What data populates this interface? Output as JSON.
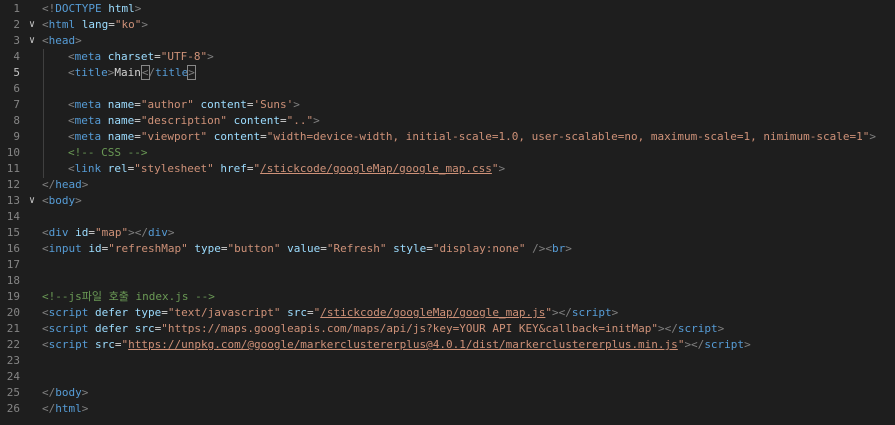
{
  "editor": {
    "language": "html",
    "current_line": 5,
    "lines": [
      {
        "num": "1",
        "fold": "",
        "tokens": [
          {
            "t": "b",
            "v": "<!"
          },
          {
            "t": "tag",
            "v": "DOCTYPE"
          },
          {
            "t": "p",
            "v": " "
          },
          {
            "t": "attr",
            "v": "html"
          },
          {
            "t": "b",
            "v": ">"
          }
        ]
      },
      {
        "num": "2",
        "fold": "v",
        "tokens": [
          {
            "t": "b",
            "v": "<"
          },
          {
            "t": "tag",
            "v": "html"
          },
          {
            "t": "p",
            "v": " "
          },
          {
            "t": "attr",
            "v": "lang"
          },
          {
            "t": "p",
            "v": "="
          },
          {
            "t": "str",
            "v": "\"ko\""
          },
          {
            "t": "b",
            "v": ">"
          }
        ]
      },
      {
        "num": "3",
        "fold": "v",
        "tokens": [
          {
            "t": "b",
            "v": "<"
          },
          {
            "t": "tag",
            "v": "head"
          },
          {
            "t": "b",
            "v": ">"
          }
        ]
      },
      {
        "num": "4",
        "fold": "",
        "indent": 1,
        "tokens": [
          {
            "t": "b",
            "v": "<"
          },
          {
            "t": "tag",
            "v": "meta"
          },
          {
            "t": "p",
            "v": " "
          },
          {
            "t": "attr",
            "v": "charset"
          },
          {
            "t": "p",
            "v": "="
          },
          {
            "t": "str",
            "v": "\"UTF-8\""
          },
          {
            "t": "b",
            "v": ">"
          }
        ]
      },
      {
        "num": "5",
        "fold": "",
        "indent": 1,
        "tokens": [
          {
            "t": "b",
            "v": "<"
          },
          {
            "t": "tag",
            "v": "title"
          },
          {
            "t": "b",
            "v": ">"
          },
          {
            "t": "p",
            "v": "Main"
          },
          {
            "t": "hlb",
            "v": "<"
          },
          {
            "t": "b",
            "v": "/"
          },
          {
            "t": "tag",
            "v": "title"
          },
          {
            "t": "hlb",
            "v": ">"
          }
        ]
      },
      {
        "num": "6",
        "fold": "",
        "indent": 1,
        "tokens": []
      },
      {
        "num": "7",
        "fold": "",
        "indent": 1,
        "tokens": [
          {
            "t": "b",
            "v": "<"
          },
          {
            "t": "tag",
            "v": "meta"
          },
          {
            "t": "p",
            "v": " "
          },
          {
            "t": "attr",
            "v": "name"
          },
          {
            "t": "p",
            "v": "="
          },
          {
            "t": "str",
            "v": "\"author\""
          },
          {
            "t": "p",
            "v": " "
          },
          {
            "t": "attr",
            "v": "content"
          },
          {
            "t": "p",
            "v": "="
          },
          {
            "t": "str",
            "v": "'Suns'"
          },
          {
            "t": "b",
            "v": ">"
          }
        ]
      },
      {
        "num": "8",
        "fold": "",
        "indent": 1,
        "tokens": [
          {
            "t": "b",
            "v": "<"
          },
          {
            "t": "tag",
            "v": "meta"
          },
          {
            "t": "p",
            "v": " "
          },
          {
            "t": "attr",
            "v": "name"
          },
          {
            "t": "p",
            "v": "="
          },
          {
            "t": "str",
            "v": "\"description\""
          },
          {
            "t": "p",
            "v": " "
          },
          {
            "t": "attr",
            "v": "content"
          },
          {
            "t": "p",
            "v": "="
          },
          {
            "t": "str",
            "v": "\"..\""
          },
          {
            "t": "b",
            "v": ">"
          }
        ]
      },
      {
        "num": "9",
        "fold": "",
        "indent": 1,
        "tokens": [
          {
            "t": "b",
            "v": "<"
          },
          {
            "t": "tag",
            "v": "meta"
          },
          {
            "t": "p",
            "v": " "
          },
          {
            "t": "attr",
            "v": "name"
          },
          {
            "t": "p",
            "v": "="
          },
          {
            "t": "str",
            "v": "\"viewport\""
          },
          {
            "t": "p",
            "v": " "
          },
          {
            "t": "attr",
            "v": "content"
          },
          {
            "t": "p",
            "v": "="
          },
          {
            "t": "str",
            "v": "\"width=device-width, initial-scale=1.0, user-scalable=no, maximum-scale=1, nimimum-scale=1\""
          },
          {
            "t": "b",
            "v": ">"
          }
        ]
      },
      {
        "num": "10",
        "fold": "",
        "indent": 1,
        "tokens": [
          {
            "t": "comment",
            "v": "<!-- CSS -->"
          }
        ]
      },
      {
        "num": "11",
        "fold": "",
        "indent": 1,
        "tokens": [
          {
            "t": "b",
            "v": "<"
          },
          {
            "t": "tag",
            "v": "link"
          },
          {
            "t": "p",
            "v": " "
          },
          {
            "t": "attr",
            "v": "rel"
          },
          {
            "t": "p",
            "v": "="
          },
          {
            "t": "str",
            "v": "\"stylesheet\""
          },
          {
            "t": "p",
            "v": " "
          },
          {
            "t": "attr",
            "v": "href"
          },
          {
            "t": "p",
            "v": "="
          },
          {
            "t": "str",
            "v": "\""
          },
          {
            "t": "link",
            "v": "/stickcode/googleMap/google_map.css"
          },
          {
            "t": "str",
            "v": "\""
          },
          {
            "t": "b",
            "v": ">"
          }
        ]
      },
      {
        "num": "12",
        "fold": "",
        "tokens": [
          {
            "t": "b",
            "v": "</"
          },
          {
            "t": "tag",
            "v": "head"
          },
          {
            "t": "b",
            "v": ">"
          }
        ]
      },
      {
        "num": "13",
        "fold": "v",
        "tokens": [
          {
            "t": "b",
            "v": "<"
          },
          {
            "t": "tag",
            "v": "body"
          },
          {
            "t": "b",
            "v": ">"
          }
        ]
      },
      {
        "num": "14",
        "fold": "",
        "tokens": []
      },
      {
        "num": "15",
        "fold": "",
        "tokens": [
          {
            "t": "b",
            "v": "<"
          },
          {
            "t": "tag",
            "v": "div"
          },
          {
            "t": "p",
            "v": " "
          },
          {
            "t": "attr",
            "v": "id"
          },
          {
            "t": "p",
            "v": "="
          },
          {
            "t": "str",
            "v": "\"map\""
          },
          {
            "t": "b",
            "v": "></"
          },
          {
            "t": "tag",
            "v": "div"
          },
          {
            "t": "b",
            "v": ">"
          }
        ]
      },
      {
        "num": "16",
        "fold": "",
        "tokens": [
          {
            "t": "b",
            "v": "<"
          },
          {
            "t": "tag",
            "v": "input"
          },
          {
            "t": "p",
            "v": " "
          },
          {
            "t": "attr",
            "v": "id"
          },
          {
            "t": "p",
            "v": "="
          },
          {
            "t": "str",
            "v": "\"refreshMap\""
          },
          {
            "t": "p",
            "v": " "
          },
          {
            "t": "attr",
            "v": "type"
          },
          {
            "t": "p",
            "v": "="
          },
          {
            "t": "str",
            "v": "\"button\""
          },
          {
            "t": "p",
            "v": " "
          },
          {
            "t": "attr",
            "v": "value"
          },
          {
            "t": "p",
            "v": "="
          },
          {
            "t": "str",
            "v": "\"Refresh\""
          },
          {
            "t": "p",
            "v": " "
          },
          {
            "t": "attr",
            "v": "style"
          },
          {
            "t": "p",
            "v": "="
          },
          {
            "t": "str",
            "v": "\"display:none\""
          },
          {
            "t": "p",
            "v": " "
          },
          {
            "t": "b",
            "v": "/><"
          },
          {
            "t": "tag",
            "v": "br"
          },
          {
            "t": "b",
            "v": ">"
          }
        ]
      },
      {
        "num": "17",
        "fold": "",
        "tokens": []
      },
      {
        "num": "18",
        "fold": "",
        "tokens": []
      },
      {
        "num": "19",
        "fold": "",
        "tokens": [
          {
            "t": "comment",
            "v": "<!--js파일 호출 index.js -->"
          }
        ]
      },
      {
        "num": "20",
        "fold": "",
        "tokens": [
          {
            "t": "b",
            "v": "<"
          },
          {
            "t": "tag",
            "v": "script"
          },
          {
            "t": "p",
            "v": " "
          },
          {
            "t": "attr",
            "v": "defer"
          },
          {
            "t": "p",
            "v": " "
          },
          {
            "t": "attr",
            "v": "type"
          },
          {
            "t": "p",
            "v": "="
          },
          {
            "t": "str",
            "v": "\"text/javascript\""
          },
          {
            "t": "p",
            "v": " "
          },
          {
            "t": "attr",
            "v": "src"
          },
          {
            "t": "p",
            "v": "="
          },
          {
            "t": "str",
            "v": "\""
          },
          {
            "t": "link",
            "v": "/stickcode/googleMap/google_map.js"
          },
          {
            "t": "str",
            "v": "\""
          },
          {
            "t": "b",
            "v": "></"
          },
          {
            "t": "tag",
            "v": "script"
          },
          {
            "t": "b",
            "v": ">"
          }
        ]
      },
      {
        "num": "21",
        "fold": "",
        "tokens": [
          {
            "t": "b",
            "v": "<"
          },
          {
            "t": "tag",
            "v": "script"
          },
          {
            "t": "p",
            "v": " "
          },
          {
            "t": "attr",
            "v": "defer"
          },
          {
            "t": "p",
            "v": " "
          },
          {
            "t": "attr",
            "v": "src"
          },
          {
            "t": "p",
            "v": "="
          },
          {
            "t": "str",
            "v": "\"https://maps.googleapis.com/maps/api/js?key=YOUR API KEY&callback=initMap\""
          },
          {
            "t": "b",
            "v": "></"
          },
          {
            "t": "tag",
            "v": "script"
          },
          {
            "t": "b",
            "v": ">"
          }
        ]
      },
      {
        "num": "22",
        "fold": "",
        "tokens": [
          {
            "t": "b",
            "v": "<"
          },
          {
            "t": "tag",
            "v": "script"
          },
          {
            "t": "p",
            "v": " "
          },
          {
            "t": "attr",
            "v": "src"
          },
          {
            "t": "p",
            "v": "="
          },
          {
            "t": "str",
            "v": "\""
          },
          {
            "t": "link",
            "v": "https://unpkg.com/@google/markerclustererplus@4.0.1/dist/markerclustererplus.min.js"
          },
          {
            "t": "str",
            "v": "\""
          },
          {
            "t": "b",
            "v": "></"
          },
          {
            "t": "tag",
            "v": "script"
          },
          {
            "t": "b",
            "v": ">"
          }
        ]
      },
      {
        "num": "23",
        "fold": "",
        "tokens": []
      },
      {
        "num": "24",
        "fold": "",
        "tokens": []
      },
      {
        "num": "25",
        "fold": "",
        "tokens": [
          {
            "t": "b",
            "v": "</"
          },
          {
            "t": "tag",
            "v": "body"
          },
          {
            "t": "b",
            "v": ">"
          }
        ]
      },
      {
        "num": "26",
        "fold": "",
        "tokens": [
          {
            "t": "b",
            "v": "</"
          },
          {
            "t": "tag",
            "v": "html"
          },
          {
            "t": "b",
            "v": ">"
          }
        ]
      }
    ]
  },
  "colors": {
    "background": "#1e1e1e",
    "tag": "#569cd6",
    "attribute": "#9cdcfe",
    "string": "#ce9178",
    "comment": "#6a9955",
    "bracket": "#808080",
    "line_number": "#858585"
  },
  "icons": {
    "fold": "chevron-down-icon"
  }
}
